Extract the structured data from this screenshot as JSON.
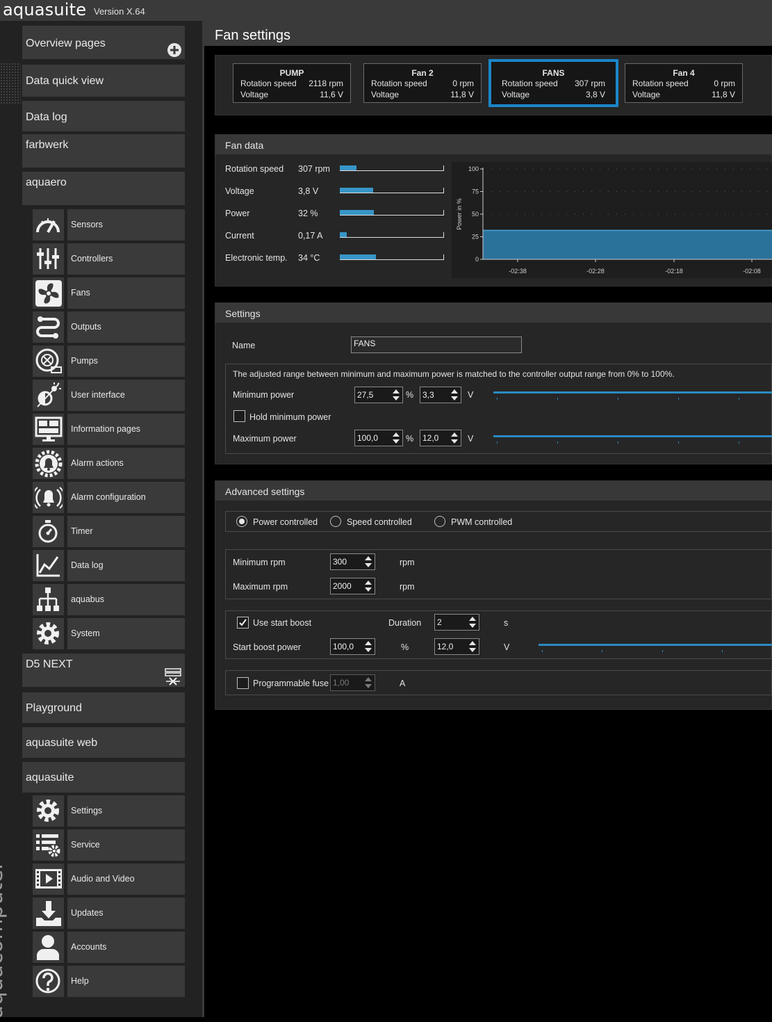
{
  "app": {
    "name": "aquasuite",
    "version": "Version X.64",
    "brand_vertical": "aquacomputer"
  },
  "sidebar": {
    "top_items": [
      {
        "label": "Overview pages"
      },
      {
        "label": "Data quick view"
      },
      {
        "label": "Data log"
      },
      {
        "label": "farbwerk"
      },
      {
        "label": "aquaero"
      }
    ],
    "aquaero_items": [
      {
        "label": "Sensors",
        "icon": "gauge-icon"
      },
      {
        "label": "Controllers",
        "icon": "sliders-icon"
      },
      {
        "label": "Fans",
        "icon": "fan-icon"
      },
      {
        "label": "Outputs",
        "icon": "outputs-icon"
      },
      {
        "label": "Pumps",
        "icon": "pump-icon"
      },
      {
        "label": "User interface",
        "icon": "brightness-icon"
      },
      {
        "label": "Information pages",
        "icon": "display-icon"
      },
      {
        "label": "Alarm actions",
        "icon": "bell-gear-icon"
      },
      {
        "label": "Alarm configuration",
        "icon": "bell-ring-icon"
      },
      {
        "label": "Timer",
        "icon": "timer-icon"
      },
      {
        "label": "Data log",
        "icon": "chart-icon"
      },
      {
        "label": "aquabus",
        "icon": "network-icon"
      },
      {
        "label": "System",
        "icon": "gear-icon"
      }
    ],
    "mid_items": [
      {
        "label": "D5 NEXT"
      },
      {
        "label": "Playground"
      },
      {
        "label": "aquasuite web"
      },
      {
        "label": "aquasuite"
      }
    ],
    "aquasuite_items": [
      {
        "label": "Settings",
        "icon": "gear-icon"
      },
      {
        "label": "Service",
        "icon": "service-icon"
      },
      {
        "label": "Audio and Video",
        "icon": "film-icon"
      },
      {
        "label": "Updates",
        "icon": "download-icon"
      },
      {
        "label": "Accounts",
        "icon": "user-icon"
      },
      {
        "label": "Help",
        "icon": "help-icon"
      }
    ]
  },
  "main": {
    "title": "Fan settings",
    "fan_cards": [
      {
        "name": "PUMP",
        "speed_label": "Rotation speed",
        "speed": "2118 rpm",
        "voltage_label": "Voltage",
        "voltage": "11,6 V",
        "active": false
      },
      {
        "name": "Fan 2",
        "speed_label": "Rotation speed",
        "speed": "0 rpm",
        "voltage_label": "Voltage",
        "voltage": "11,8 V",
        "active": false
      },
      {
        "name": "FANS",
        "speed_label": "Rotation speed",
        "speed": "307 rpm",
        "voltage_label": "Voltage",
        "voltage": "3,8 V",
        "active": true
      },
      {
        "name": "Fan 4",
        "speed_label": "Rotation speed",
        "speed": "0 rpm",
        "voltage_label": "Voltage",
        "voltage": "11,8 V",
        "active": false
      }
    ],
    "fan_data": {
      "title": "Fan data",
      "rows": [
        {
          "label": "Rotation speed",
          "value": "307 rpm",
          "level": 0.16
        },
        {
          "label": "Voltage",
          "value": "3,8 V",
          "level": 0.32
        },
        {
          "label": "Power",
          "value": "32 %",
          "level": 0.33
        },
        {
          "label": "Current",
          "value": "0,17 A",
          "level": 0.07
        },
        {
          "label": "Electronic temp.",
          "value": "34 °C",
          "level": 0.35
        }
      ]
    },
    "settings": {
      "title": "Settings",
      "name_label": "Name",
      "name_value": "FANS",
      "range_note": "The adjusted range between minimum and maximum power is matched to the controller output range from 0% to 100%.",
      "min_power_label": "Minimum power",
      "min_power_pct": "27,5",
      "min_power_volt": "3,3",
      "hold_label": "Hold minimum power",
      "max_power_label": "Maximum power",
      "max_power_pct": "100,0",
      "max_power_volt": "12,0",
      "unit_pct": "%",
      "unit_v": "V"
    },
    "advanced": {
      "title": "Advanced settings",
      "modes": [
        {
          "label": "Power controlled",
          "selected": true
        },
        {
          "label": "Speed controlled",
          "selected": false
        },
        {
          "label": "PWM controlled",
          "selected": false
        }
      ],
      "min_rpm_label": "Minimum rpm",
      "min_rpm": "300",
      "max_rpm_label": "Maximum rpm",
      "max_rpm": "2000",
      "rpm_unit": "rpm",
      "start_boost_label": "Use start boost",
      "start_boost_checked": true,
      "duration_label": "Duration",
      "duration": "2",
      "duration_unit": "s",
      "boost_power_label": "Start boost power",
      "boost_power_pct": "100,0",
      "boost_power_volt": "12,0",
      "fuse_label": "Programmable fuse",
      "fuse_value": "1,00",
      "fuse_unit": "A"
    }
  },
  "chart_data": {
    "type": "area",
    "ylabel": "Power in %",
    "ylim": [
      0,
      100
    ],
    "yticks": [
      "100",
      "75",
      "50",
      "25",
      "0"
    ],
    "xticks": [
      "-02:38",
      "-02:28",
      "-02:18",
      "-02:08"
    ],
    "series": [
      {
        "values": [
          32,
          32,
          32,
          32
        ]
      }
    ],
    "color": "#2c7ba8"
  }
}
